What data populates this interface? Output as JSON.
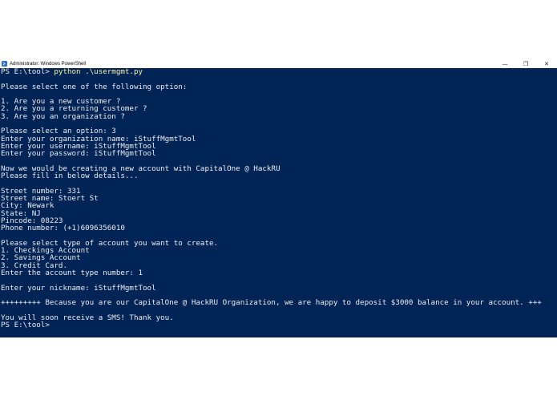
{
  "window": {
    "title": "Administrator: Windows PowerShell",
    "icon": "powershell-icon",
    "controls": {
      "minimize": "—",
      "restore": "❐",
      "close": "✕"
    }
  },
  "console": {
    "prompt_1": "PS E:\\tool> ",
    "command": "python .\\usermgmt.py",
    "lines": [
      "",
      "Please select one of the following option:",
      "",
      "1. Are you a new customer ?",
      "2. Are you a returning customer ?",
      "3. Are you an organization ?",
      "",
      "Please select an option: 3",
      "Enter your organization name: iStuffMgmtTool",
      "Enter your username: iStuffMgmtTool",
      "Enter your password: iStuffMgmtTool",
      "",
      "Now we would be creating a new account with CapitalOne @ HackRU",
      "Please fill in below details...",
      "",
      "Street number: 331",
      "Street name: Stoert St",
      "City: Newark",
      "State: NJ",
      "Pincode: 08223",
      "Phone number: (+1)6096356010",
      "",
      "Please select type of account you want to create.",
      "1. Checkings Account",
      "2. Savings Account",
      "3. Credit Card.",
      "Enter the account type number: 1",
      "",
      "Enter your nickname: iStuffMgmtTool",
      "",
      "+++++++++ Because you are our CapitalOne @ HackRU Organization, we are happy to deposit $3000 balance in your account. +++",
      "",
      "You will soon receive a SMS! Thank you.",
      "PS E:\\tool>"
    ]
  },
  "colors": {
    "console_bg": "#012456",
    "console_text": "#eeedf0",
    "command_text": "#f9f1a5"
  }
}
